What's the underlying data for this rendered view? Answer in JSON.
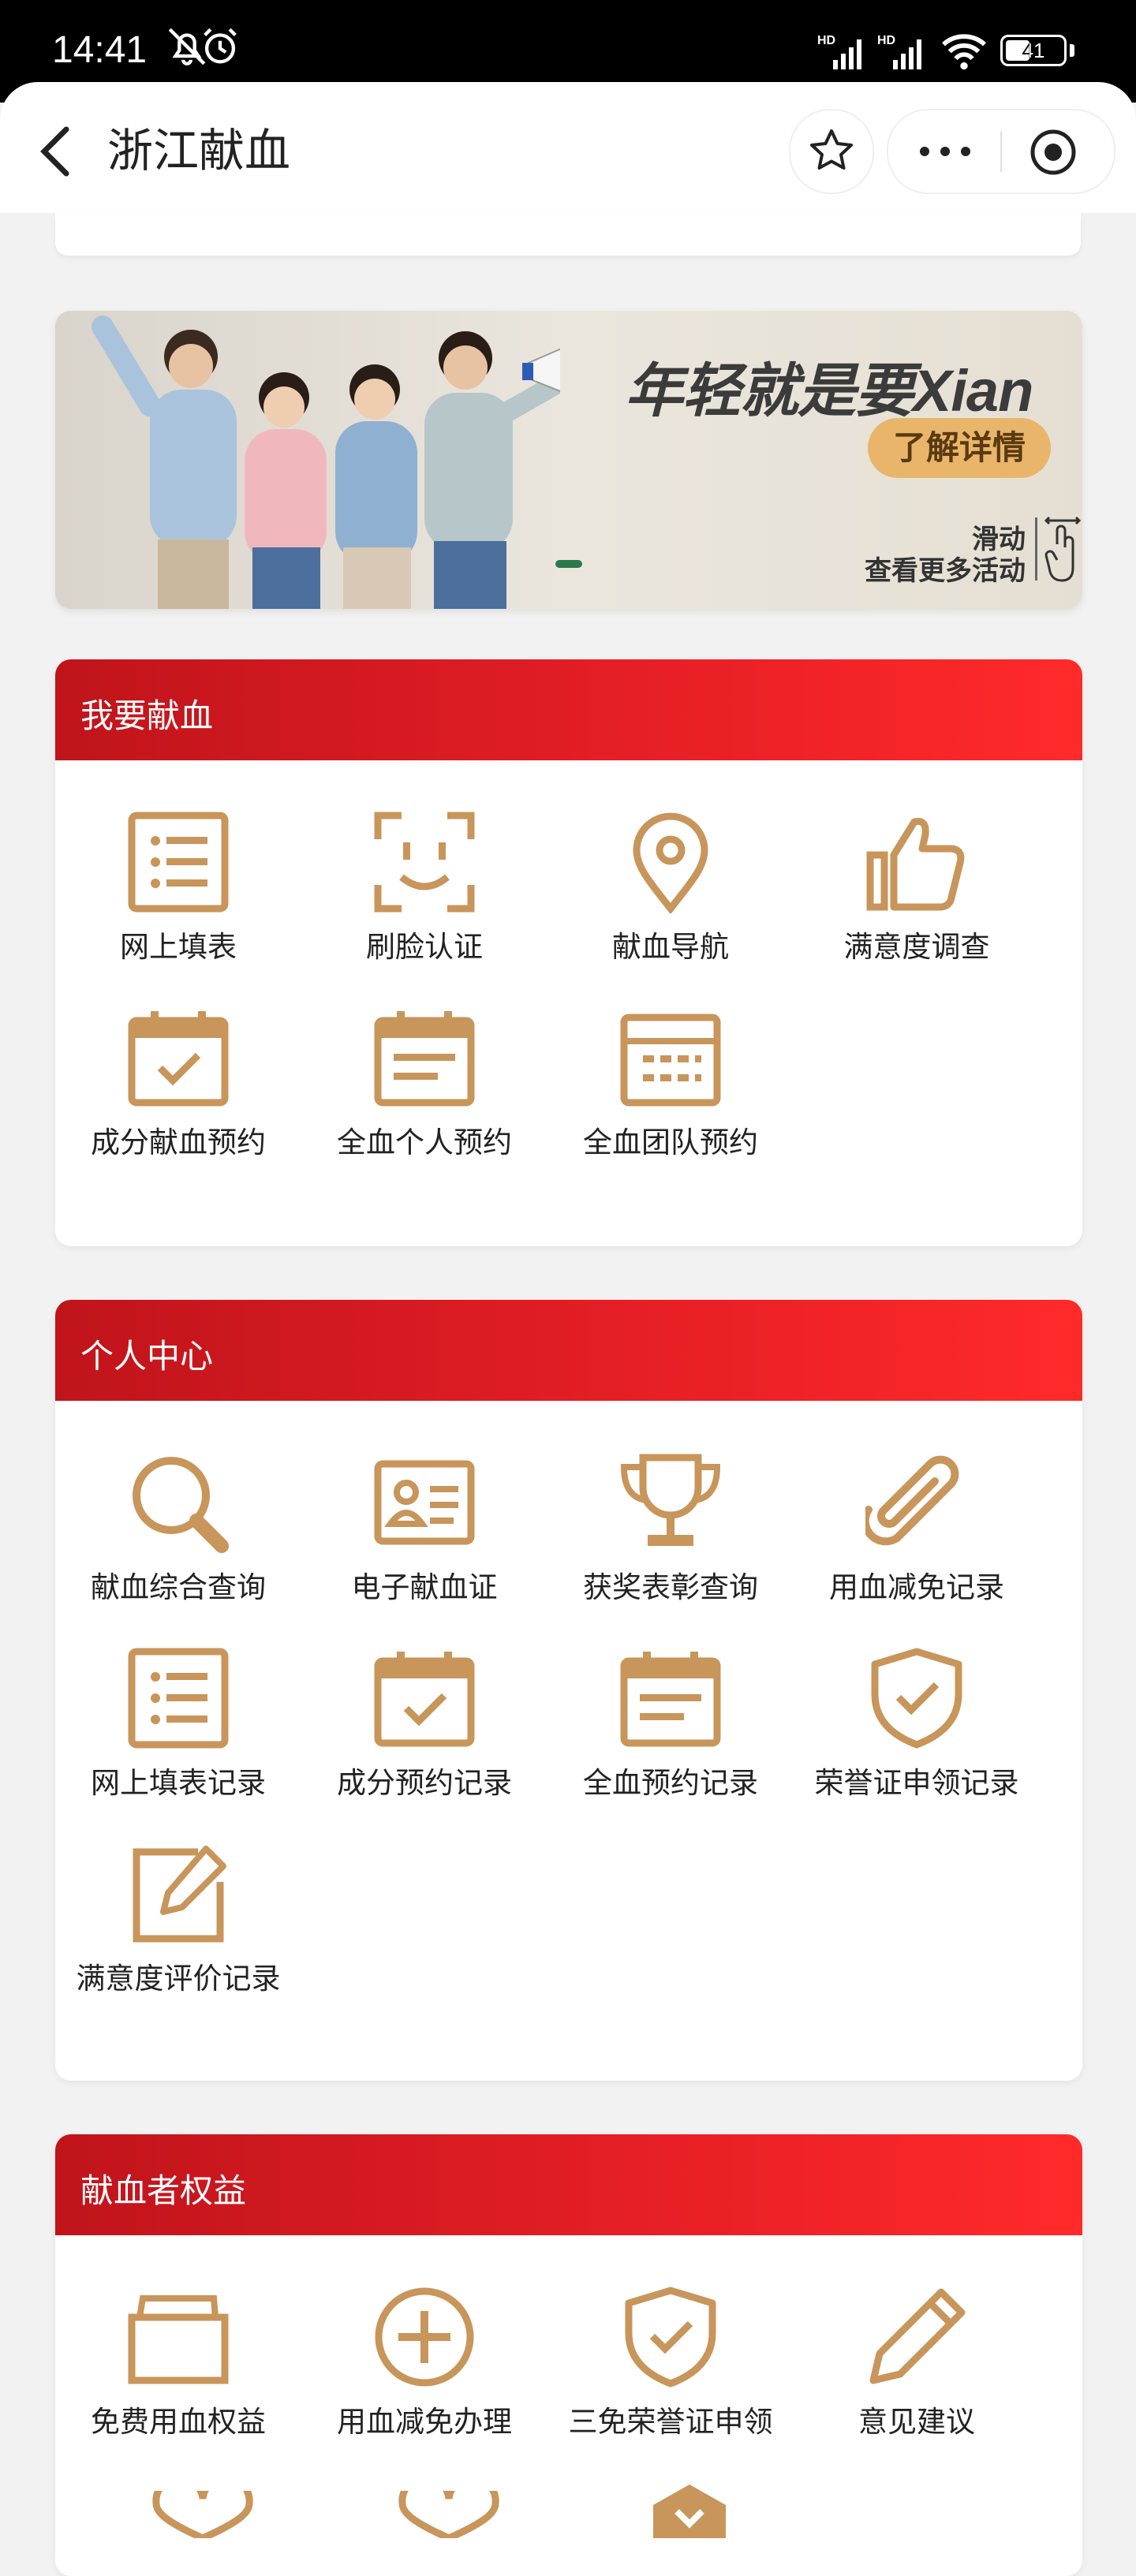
{
  "statusbar": {
    "time": "14:41",
    "battery": "41"
  },
  "navbar": {
    "title": "浙江献血"
  },
  "banner": {
    "slogan": "年轻就是要Xian",
    "learn_more": "了解详情",
    "swipe_line1": "滑动",
    "swipe_line2": "查看更多活动"
  },
  "sections": [
    {
      "title": "我要献血",
      "items": [
        {
          "label": "网上填表",
          "icon": "list-form-icon"
        },
        {
          "label": "刷脸认证",
          "icon": "face-scan-icon"
        },
        {
          "label": "献血导航",
          "icon": "location-pin-icon"
        },
        {
          "label": "满意度调查",
          "icon": "thumbs-up-icon"
        },
        {
          "label": "成分献血预约",
          "icon": "calendar-check-icon"
        },
        {
          "label": "全血个人预约",
          "icon": "calendar-lines-icon"
        },
        {
          "label": "全血团队预约",
          "icon": "calendar-grid-icon"
        }
      ]
    },
    {
      "title": "个人中心",
      "items": [
        {
          "label": "献血综合查询",
          "icon": "search-icon"
        },
        {
          "label": "电子献血证",
          "icon": "id-card-icon"
        },
        {
          "label": "获奖表彰查询",
          "icon": "trophy-icon"
        },
        {
          "label": "用血减免记录",
          "icon": "paperclip-icon"
        },
        {
          "label": "网上填表记录",
          "icon": "list-form-icon"
        },
        {
          "label": "成分预约记录",
          "icon": "calendar-check-icon"
        },
        {
          "label": "全血预约记录",
          "icon": "calendar-lines-icon"
        },
        {
          "label": "荣誉证申领记录",
          "icon": "shield-check-icon"
        },
        {
          "label": "满意度评价记录",
          "icon": "edit-note-icon"
        }
      ]
    },
    {
      "title": "献血者权益",
      "items": [
        {
          "label": "免费用血权益",
          "icon": "folder-icon"
        },
        {
          "label": "用血减免办理",
          "icon": "plus-circle-icon"
        },
        {
          "label": "三免荣誉证申领",
          "icon": "shield-check-icon"
        },
        {
          "label": "意见建议",
          "icon": "pencil-icon"
        }
      ]
    }
  ],
  "colors": {
    "accent_red": "#d8161d",
    "icon_gold": "#c8955a"
  }
}
